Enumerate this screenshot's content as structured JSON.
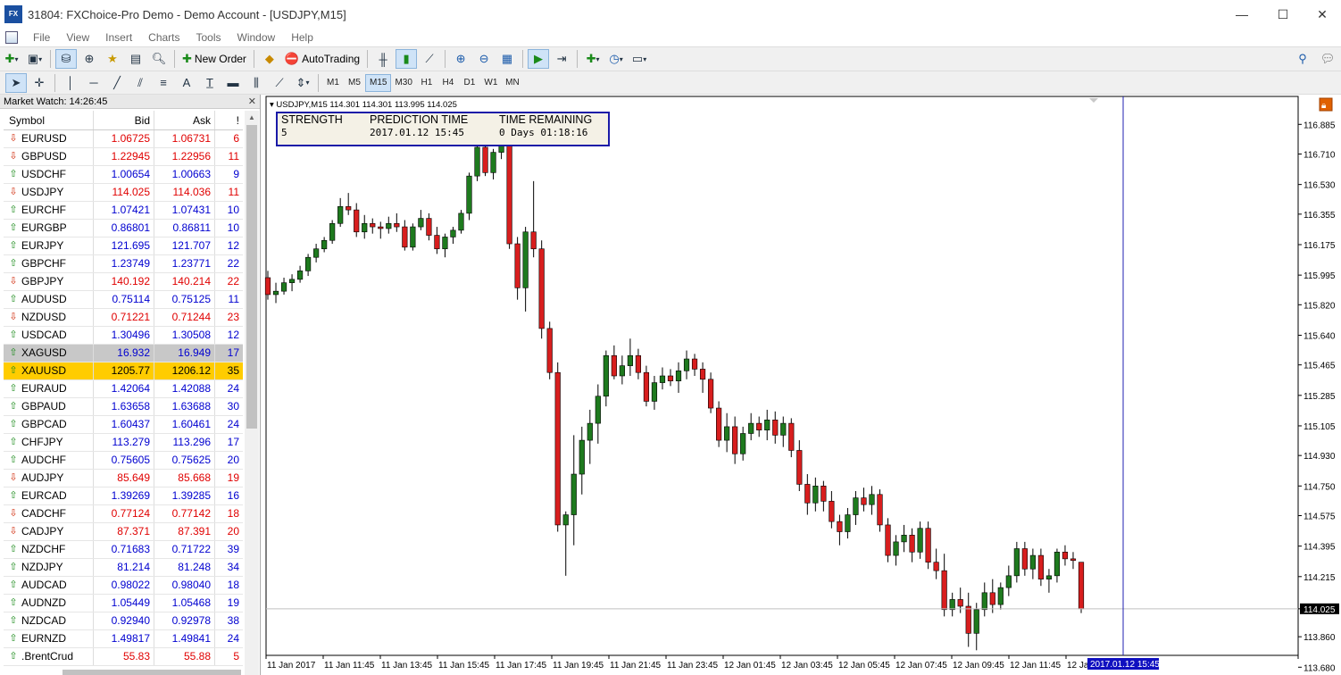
{
  "window": {
    "title": "31804: FXChoice-Pro Demo - Demo Account - [USDJPY,M15]",
    "logo": "FX",
    "controls": [
      "—",
      "☐",
      "✕"
    ]
  },
  "menu": [
    "File",
    "View",
    "Insert",
    "Charts",
    "Tools",
    "Window",
    "Help"
  ],
  "toolbar": {
    "new_order_label": "New Order",
    "autotrading_label": "AutoTrading",
    "timeframes": [
      "M1",
      "M5",
      "M15",
      "M30",
      "H1",
      "H4",
      "D1",
      "W1",
      "MN"
    ],
    "active_timeframe": "M15"
  },
  "market_watch": {
    "title": "Market Watch: 14:26:45",
    "columns": {
      "symbol": "Symbol",
      "bid": "Bid",
      "ask": "Ask",
      "spread": "!"
    },
    "rows": [
      {
        "dir": "down",
        "symbol": "EURUSD",
        "bid": "1.06725",
        "ask": "1.06731",
        "spread": "6",
        "color": "red"
      },
      {
        "dir": "down",
        "symbol": "GBPUSD",
        "bid": "1.22945",
        "ask": "1.22956",
        "spread": "11",
        "color": "red"
      },
      {
        "dir": "up",
        "symbol": "USDCHF",
        "bid": "1.00654",
        "ask": "1.00663",
        "spread": "9",
        "color": "blue"
      },
      {
        "dir": "down",
        "symbol": "USDJPY",
        "bid": "114.025",
        "ask": "114.036",
        "spread": "11",
        "color": "red"
      },
      {
        "dir": "up",
        "symbol": "EURCHF",
        "bid": "1.07421",
        "ask": "1.07431",
        "spread": "10",
        "color": "blue"
      },
      {
        "dir": "up",
        "symbol": "EURGBP",
        "bid": "0.86801",
        "ask": "0.86811",
        "spread": "10",
        "color": "blue"
      },
      {
        "dir": "up",
        "symbol": "EURJPY",
        "bid": "121.695",
        "ask": "121.707",
        "spread": "12",
        "color": "blue"
      },
      {
        "dir": "up",
        "symbol": "GBPCHF",
        "bid": "1.23749",
        "ask": "1.23771",
        "spread": "22",
        "color": "blue"
      },
      {
        "dir": "down",
        "symbol": "GBPJPY",
        "bid": "140.192",
        "ask": "140.214",
        "spread": "22",
        "color": "red"
      },
      {
        "dir": "up",
        "symbol": "AUDUSD",
        "bid": "0.75114",
        "ask": "0.75125",
        "spread": "11",
        "color": "blue"
      },
      {
        "dir": "down",
        "symbol": "NZDUSD",
        "bid": "0.71221",
        "ask": "0.71244",
        "spread": "23",
        "color": "red"
      },
      {
        "dir": "up",
        "symbol": "USDCAD",
        "bid": "1.30496",
        "ask": "1.30508",
        "spread": "12",
        "color": "blue"
      },
      {
        "dir": "up",
        "symbol": "XAGUSD",
        "bid": "16.932",
        "ask": "16.949",
        "spread": "17",
        "color": "blue",
        "state": "sel"
      },
      {
        "dir": "up",
        "symbol": "XAUUSD",
        "bid": "1205.77",
        "ask": "1206.12",
        "spread": "35",
        "color": "blue",
        "state": "hl"
      },
      {
        "dir": "up",
        "symbol": "EURAUD",
        "bid": "1.42064",
        "ask": "1.42088",
        "spread": "24",
        "color": "blue"
      },
      {
        "dir": "up",
        "symbol": "GBPAUD",
        "bid": "1.63658",
        "ask": "1.63688",
        "spread": "30",
        "color": "blue"
      },
      {
        "dir": "up",
        "symbol": "GBPCAD",
        "bid": "1.60437",
        "ask": "1.60461",
        "spread": "24",
        "color": "blue"
      },
      {
        "dir": "up",
        "symbol": "CHFJPY",
        "bid": "113.279",
        "ask": "113.296",
        "spread": "17",
        "color": "blue"
      },
      {
        "dir": "up",
        "symbol": "AUDCHF",
        "bid": "0.75605",
        "ask": "0.75625",
        "spread": "20",
        "color": "blue"
      },
      {
        "dir": "down",
        "symbol": "AUDJPY",
        "bid": "85.649",
        "ask": "85.668",
        "spread": "19",
        "color": "red"
      },
      {
        "dir": "up",
        "symbol": "EURCAD",
        "bid": "1.39269",
        "ask": "1.39285",
        "spread": "16",
        "color": "blue"
      },
      {
        "dir": "down",
        "symbol": "CADCHF",
        "bid": "0.77124",
        "ask": "0.77142",
        "spread": "18",
        "color": "red"
      },
      {
        "dir": "down",
        "symbol": "CADJPY",
        "bid": "87.371",
        "ask": "87.391",
        "spread": "20",
        "color": "red"
      },
      {
        "dir": "up",
        "symbol": "NZDCHF",
        "bid": "0.71683",
        "ask": "0.71722",
        "spread": "39",
        "color": "blue"
      },
      {
        "dir": "up",
        "symbol": "NZDJPY",
        "bid": "81.214",
        "ask": "81.248",
        "spread": "34",
        "color": "blue"
      },
      {
        "dir": "up",
        "symbol": "AUDCAD",
        "bid": "0.98022",
        "ask": "0.98040",
        "spread": "18",
        "color": "blue"
      },
      {
        "dir": "up",
        "symbol": "AUDNZD",
        "bid": "1.05449",
        "ask": "1.05468",
        "spread": "19",
        "color": "blue"
      },
      {
        "dir": "up",
        "symbol": "NZDCAD",
        "bid": "0.92940",
        "ask": "0.92978",
        "spread": "38",
        "color": "blue"
      },
      {
        "dir": "up",
        "symbol": "EURNZD",
        "bid": "1.49817",
        "ask": "1.49841",
        "spread": "24",
        "color": "blue"
      },
      {
        "dir": "up",
        "symbol": ".BrentCrud",
        "bid": "55.83",
        "ask": "55.88",
        "spread": "5",
        "color": "red"
      }
    ]
  },
  "indicator": {
    "strength_label": "STRENGTH",
    "strength_value": "5",
    "prediction_label": "PREDICTION TIME",
    "prediction_value": "2017.01.12 15:45",
    "remaining_label": "TIME REMAINING",
    "remaining_value": "0 Days 01:18:16"
  },
  "chart_data": {
    "type": "candlestick",
    "symbol_info": "USDJPY,M15  114.301 114.301 113.995 114.025",
    "current_price": "114.025",
    "cursor_time": "2017.01.12 15:45",
    "ylim": [
      113.75,
      117.05
    ],
    "y_ticks": [
      "116.885",
      "116.710",
      "116.530",
      "116.355",
      "116.175",
      "115.995",
      "115.820",
      "115.640",
      "115.465",
      "115.285",
      "115.105",
      "114.930",
      "114.750",
      "114.575",
      "114.395",
      "114.215",
      "114.025",
      "113.860",
      "113.680"
    ],
    "x_ticks": [
      "11 Jan 2017",
      "11 Jan 11:45",
      "11 Jan 13:45",
      "11 Jan 15:45",
      "11 Jan 17:45",
      "11 Jan 19:45",
      "11 Jan 21:45",
      "11 Jan 23:45",
      "12 Jan 01:45",
      "12 Jan 03:45",
      "12 Jan 05:45",
      "12 Jan 07:45",
      "12 Jan 09:45",
      "12 Jan 11:45",
      "12 Jan"
    ],
    "colors": {
      "bull": "#1e7a1e",
      "bear": "#d81e1e",
      "wick": "#000000",
      "cursor": "#2020b0",
      "price_tag": "#000000",
      "time_tag": "#1010c0"
    },
    "candles": [
      [
        115.98,
        116.02,
        115.85,
        115.88
      ],
      [
        115.88,
        115.95,
        115.83,
        115.9
      ],
      [
        115.9,
        115.98,
        115.88,
        115.95
      ],
      [
        115.95,
        116.0,
        115.9,
        115.97
      ],
      [
        115.97,
        116.05,
        115.95,
        116.02
      ],
      [
        116.02,
        116.12,
        115.99,
        116.1
      ],
      [
        116.1,
        116.18,
        116.07,
        116.15
      ],
      [
        116.15,
        116.22,
        116.13,
        116.2
      ],
      [
        116.2,
        116.32,
        116.18,
        116.3
      ],
      [
        116.3,
        116.45,
        116.28,
        116.4
      ],
      [
        116.4,
        116.48,
        116.35,
        116.38
      ],
      [
        116.38,
        116.42,
        116.22,
        116.25
      ],
      [
        116.25,
        116.35,
        116.21,
        116.3
      ],
      [
        116.3,
        116.33,
        116.24,
        116.28
      ],
      [
        116.28,
        116.31,
        116.21,
        116.27
      ],
      [
        116.27,
        116.34,
        116.24,
        116.3
      ],
      [
        116.3,
        116.36,
        116.25,
        116.28
      ],
      [
        116.28,
        116.32,
        116.14,
        116.16
      ],
      [
        116.16,
        116.3,
        116.14,
        116.28
      ],
      [
        116.28,
        116.38,
        116.26,
        116.33
      ],
      [
        116.33,
        116.36,
        116.2,
        116.23
      ],
      [
        116.23,
        116.28,
        116.12,
        116.15
      ],
      [
        116.15,
        116.24,
        116.1,
        116.22
      ],
      [
        116.22,
        116.28,
        116.18,
        116.26
      ],
      [
        116.26,
        116.38,
        116.24,
        116.36
      ],
      [
        116.36,
        116.6,
        116.32,
        116.58
      ],
      [
        116.58,
        116.78,
        116.55,
        116.75
      ],
      [
        116.75,
        116.8,
        116.58,
        116.6
      ],
      [
        116.6,
        116.74,
        116.56,
        116.72
      ],
      [
        116.72,
        116.92,
        116.68,
        116.85
      ],
      [
        116.85,
        116.9,
        116.15,
        116.18
      ],
      [
        116.18,
        116.22,
        115.85,
        115.92
      ],
      [
        115.92,
        116.28,
        115.78,
        116.25
      ],
      [
        116.25,
        116.55,
        116.1,
        116.15
      ],
      [
        116.15,
        116.2,
        115.62,
        115.68
      ],
      [
        115.68,
        115.72,
        115.38,
        115.42
      ],
      [
        115.42,
        115.48,
        114.48,
        114.52
      ],
      [
        114.52,
        114.6,
        114.22,
        114.58
      ],
      [
        114.58,
        115.05,
        114.4,
        114.82
      ],
      [
        114.82,
        115.1,
        114.7,
        115.02
      ],
      [
        115.02,
        115.2,
        114.88,
        115.12
      ],
      [
        115.12,
        115.35,
        115.0,
        115.28
      ],
      [
        115.28,
        115.55,
        115.22,
        115.52
      ],
      [
        115.52,
        115.58,
        115.38,
        115.4
      ],
      [
        115.4,
        115.52,
        115.35,
        115.46
      ],
      [
        115.46,
        115.62,
        115.4,
        115.52
      ],
      [
        115.52,
        115.56,
        115.38,
        115.42
      ],
      [
        115.42,
        115.46,
        115.22,
        115.25
      ],
      [
        115.25,
        115.4,
        115.2,
        115.36
      ],
      [
        115.36,
        115.45,
        115.32,
        115.4
      ],
      [
        115.4,
        115.44,
        115.34,
        115.37
      ],
      [
        115.37,
        115.48,
        115.3,
        115.43
      ],
      [
        115.43,
        115.55,
        115.38,
        115.5
      ],
      [
        115.5,
        115.53,
        115.4,
        115.44
      ],
      [
        115.44,
        115.48,
        115.3,
        115.38
      ],
      [
        115.38,
        115.42,
        115.18,
        115.21
      ],
      [
        115.21,
        115.25,
        114.98,
        115.02
      ],
      [
        115.02,
        115.18,
        114.95,
        115.1
      ],
      [
        115.1,
        115.16,
        114.88,
        114.94
      ],
      [
        114.94,
        115.1,
        114.9,
        115.06
      ],
      [
        115.06,
        115.18,
        115.02,
        115.12
      ],
      [
        115.12,
        115.16,
        115.04,
        115.08
      ],
      [
        115.08,
        115.2,
        115.02,
        115.14
      ],
      [
        115.14,
        115.19,
        115.0,
        115.05
      ],
      [
        115.05,
        115.16,
        114.98,
        115.12
      ],
      [
        115.12,
        115.15,
        114.92,
        114.96
      ],
      [
        114.96,
        115.02,
        114.72,
        114.76
      ],
      [
        114.76,
        114.82,
        114.58,
        114.65
      ],
      [
        114.65,
        114.8,
        114.6,
        114.75
      ],
      [
        114.75,
        114.78,
        114.6,
        114.66
      ],
      [
        114.66,
        114.72,
        114.5,
        114.54
      ],
      [
        114.54,
        114.58,
        114.4,
        114.48
      ],
      [
        114.48,
        114.62,
        114.44,
        114.58
      ],
      [
        114.58,
        114.72,
        114.52,
        114.68
      ],
      [
        114.68,
        114.74,
        114.6,
        114.64
      ],
      [
        114.64,
        114.75,
        114.58,
        114.7
      ],
      [
        114.7,
        114.73,
        114.48,
        114.52
      ],
      [
        114.52,
        114.56,
        114.3,
        114.34
      ],
      [
        114.34,
        114.46,
        114.28,
        114.42
      ],
      [
        114.42,
        114.52,
        114.36,
        114.46
      ],
      [
        114.46,
        114.5,
        114.3,
        114.36
      ],
      [
        114.36,
        114.54,
        114.32,
        114.5
      ],
      [
        114.5,
        114.54,
        114.26,
        114.3
      ],
      [
        114.3,
        114.38,
        114.2,
        114.25
      ],
      [
        114.25,
        114.35,
        113.98,
        114.02
      ],
      [
        114.02,
        114.12,
        113.98,
        114.08
      ],
      [
        114.08,
        114.15,
        114.0,
        114.04
      ],
      [
        114.04,
        114.12,
        113.8,
        113.88
      ],
      [
        113.88,
        114.06,
        113.78,
        114.02
      ],
      [
        114.02,
        114.18,
        113.98,
        114.12
      ],
      [
        114.12,
        114.2,
        114.0,
        114.05
      ],
      [
        114.05,
        114.18,
        114.02,
        114.15
      ],
      [
        114.15,
        114.28,
        114.1,
        114.22
      ],
      [
        114.22,
        114.42,
        114.18,
        114.38
      ],
      [
        114.38,
        114.42,
        114.22,
        114.26
      ],
      [
        114.26,
        114.38,
        114.2,
        114.34
      ],
      [
        114.34,
        114.38,
        114.16,
        114.2
      ],
      [
        114.2,
        114.26,
        114.12,
        114.22
      ],
      [
        114.22,
        114.38,
        114.18,
        114.36
      ],
      [
        114.36,
        114.4,
        114.28,
        114.32
      ],
      [
        114.32,
        114.36,
        114.26,
        114.31
      ],
      [
        114.3,
        114.3,
        114.0,
        114.025
      ]
    ]
  }
}
